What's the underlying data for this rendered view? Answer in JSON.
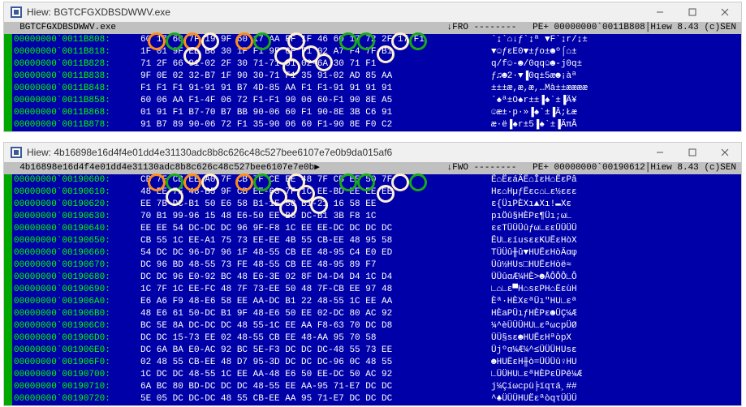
{
  "window1": {
    "title": "Hiew: BGTCFGXDBSDWWV.exe",
    "filename": "  BGTCFGXDBSDWWV.exe",
    "headerRight": "↓FRO --------   PE+ 00000000`0011B808│Hiew 8.43 (c)SEN",
    "rows": [
      {
        "addr": "00000000`0011B808:",
        "hex": "60 17 60 7F 19 9F 60 17 AA FF 1F 46 60 17 72 2F 17 F1",
        "asc": "`↨`⌂↓ƒ`↨ª ▼F`↨r/↨±"
      },
      {
        "addr": "00000000`0011B818:",
        "hex": "1F 01 9F EE B8 30 1F F1 9F 6F F1 02 A7 F4 7F B1",
        "asc": "▼☺ƒεE0▼±ƒo±☻º⌠⌂±"
      },
      {
        "addr": "00000000`0011B828:",
        "hex": "71 2F 66 91-02 2F 30 71-71 01 02-6A 30 71 F1",
        "asc": "q/f☺-☻/0qq☺☻-j0q±"
      },
      {
        "addr": "00000000`0011B838:",
        "hex": "9F 0E 02 32-B7 1F 90 30-71 F1 35 91-02 AD 85 AA",
        "asc": "ƒ♫☻2·▼▐0q±5æ☻¡àª"
      },
      {
        "addr": "00000000`0011B848:",
        "hex": "F1 F1 F1 91-91 91 B7 4D-85 AA F1 F1-91 91 91 91",
        "asc": "±±±æ,æ,æ,…Mà±±ææææ"
      },
      {
        "addr": "00000000`0011B858:",
        "hex": "60 06 AA F1-4F 06 72 F1-F1 90 06 60-F1 90 8E A5",
        "asc": "`♠ª±O♠r±±▐♠`±▐Ä¥"
      },
      {
        "addr": "00000000`0011B868:",
        "hex": "01 91 F1 B7-70 B7 BB 90-06 60 F1 90-8E 3B C6 91",
        "asc": "☺æ±·p·»▐♠`±▐Ä;Łæ"
      },
      {
        "addr": "00000000`0011B878:",
        "hex": "91 B7 89 90-06 72 F1 35-90 06 60 F1-90 8E F0 C2",
        "asc": "æ·ë▐♠r±5▐♠`±▐ÄπÂ"
      }
    ]
  },
  "window2": {
    "title": "Hiew: 4b16898e16d4f4e01dd4e31130adc8b8c626c48c527bee6107e7e0b9da015af6",
    "filename": "  4b16898e16d4f4e01dd4e31130adc8b8c626c48c527bee6107e7e0b▶",
    "headerRight": "↓FWO --------   PE+ 00000000`00190612│Hiew 8.43 (c)SEN",
    "rows": [
      {
        "addr": "00000000`00190600:",
        "hex": "CB 7F CB EE A0 7F CB 7F CE EE 48 7F CB EE 50 7F",
        "asc": "Ë⌂ËεáÄË⌂ÎεH⌂ËεPâ"
      },
      {
        "addr": "00000000`00190610:",
        "hex": "48 EE 7F 48-B5 9F CB EE-63 7F 1C EE-BD EE EE EE",
        "asc": "Hε⌂HµƒËεc⌂∟ε½εεε"
      },
      {
        "addr": "00000000`00190620:",
        "hex": "EE 7B DC-B1 50 E6 58 B1-1E 58 B1-21 16 58 EE",
        "asc": "ε{ÜıPÈXı▲Xı!▬Xε"
      },
      {
        "addr": "00000000`00190630:",
        "hex": "70 B1 99-96 15 48 E6-50 EE B6 DC-B1 3B F8 1C",
        "asc": "pıÖû§HÈPε¶Üı;ω∟"
      },
      {
        "addr": "00000000`00190640:",
        "hex": "EE EE 54 DC-DC DC 96 9F-F8 1C EE EE-DC DC DC DC",
        "asc": "εεTÜÜÜûƒω∟εεÜÜÜÜ"
      },
      {
        "addr": "00000000`00190650:",
        "hex": "CB 55 1C EE-A1 75 73 EE-EE 4B 55 CB-EE 48 95 58",
        "asc": "ËU∟εíusεεKUËεHòX"
      },
      {
        "addr": "00000000`00190660:",
        "hex": "54 DC DC 96-D7 96 1F 48-55 CB EE 48-95 C4 E0 ED",
        "asc": "TÜÜû╫û▼HUËεHòÄαφ"
      },
      {
        "addr": "00000000`00190670:",
        "hex": "DC 96 BD 48-55 73 FE 48-55 CB EE 48-95 89 F7",
        "asc": "Üû½HUs□HUËεHòë≈"
      },
      {
        "addr": "00000000`00190680:",
        "hex": "DC DC 96 E0-92 BC 48 E6-3E 02 8F D4-D4 D4 1C D4",
        "asc": "ÜÜûαÆ¼HÈ>☻ÅÔÔÔ∟Ô"
      },
      {
        "addr": "00000000`00190690:",
        "hex": "1C 7F 1C EE-FC 48 7F 73-EE 50 48 7F-CB EE 97 48",
        "asc": "∟⌂∟ε▀H⌂sεPH⌂ËεùH"
      },
      {
        "addr": "00000000`001906A0:",
        "hex": "E6 A6 F9 48-E6 58 EE AA-DC B1 22 48-55 1C EE AA",
        "asc": "Èª∙HÈXεªÜı\"HU∟εª"
      },
      {
        "addr": "00000000`001906B0:",
        "hex": "48 E6 61 50-DC B1 9F 48-E6 50 EE 02-DC 80 AC 92",
        "asc": "HÈaPÜıƒHÈPε☻ÜÇ¼Æ"
      },
      {
        "addr": "00000000`001906C0:",
        "hex": "BC 5E 8A DC-DC DC 48 55-1C EE AA F8-63 70 DC D8",
        "asc": "¼^èÜÜÜHU∟εªωcpÜØ"
      },
      {
        "addr": "00000000`001906D0:",
        "hex": "DC DC 15-73 EE 02 48-55 CB EE 48-AA 95 70 58",
        "asc": "ÜÜ§sε☻HUËεHªòpX"
      },
      {
        "addr": "00000000`001906E0:",
        "hex": "DC 6A BA E0-AC 92 BC 5E-F3 DC DC DC-48 55 73 EE",
        "asc": "Üjºα¼Æ¼^≤ÜÜÜHUsε"
      },
      {
        "addr": "00000000`001906F0:",
        "hex": "02 48 55 CB-EE 48 D7 95-3D DC DC DC-96 0C 48 55",
        "asc": "☻HUËεH╫ò=ÜÜÜû♀HU"
      },
      {
        "addr": "00000000`00190700:",
        "hex": "1C DC DC 48-55 1C EE AA-48 E6 50 EE-DC 50 AC 92",
        "asc": "∟ÜÜHU∟εªHÈPεÜPê¼Æ"
      },
      {
        "addr": "00000000`00190710:",
        "hex": "6A BC 80 BD-DC DC DC 48-55 EE AA-95 71-E7 DC DC",
        "asc": "j¼Çíωcpü╞ïqτá¸##"
      },
      {
        "addr": "00000000`00190720:",
        "hex": "5E 05 DC DC-DC 48 55 CB-EE AA 95 71-E7 DC DC DC",
        "asc": "^♣ÜÜÜHUËεªòqτÜÜÜ"
      }
    ]
  }
}
